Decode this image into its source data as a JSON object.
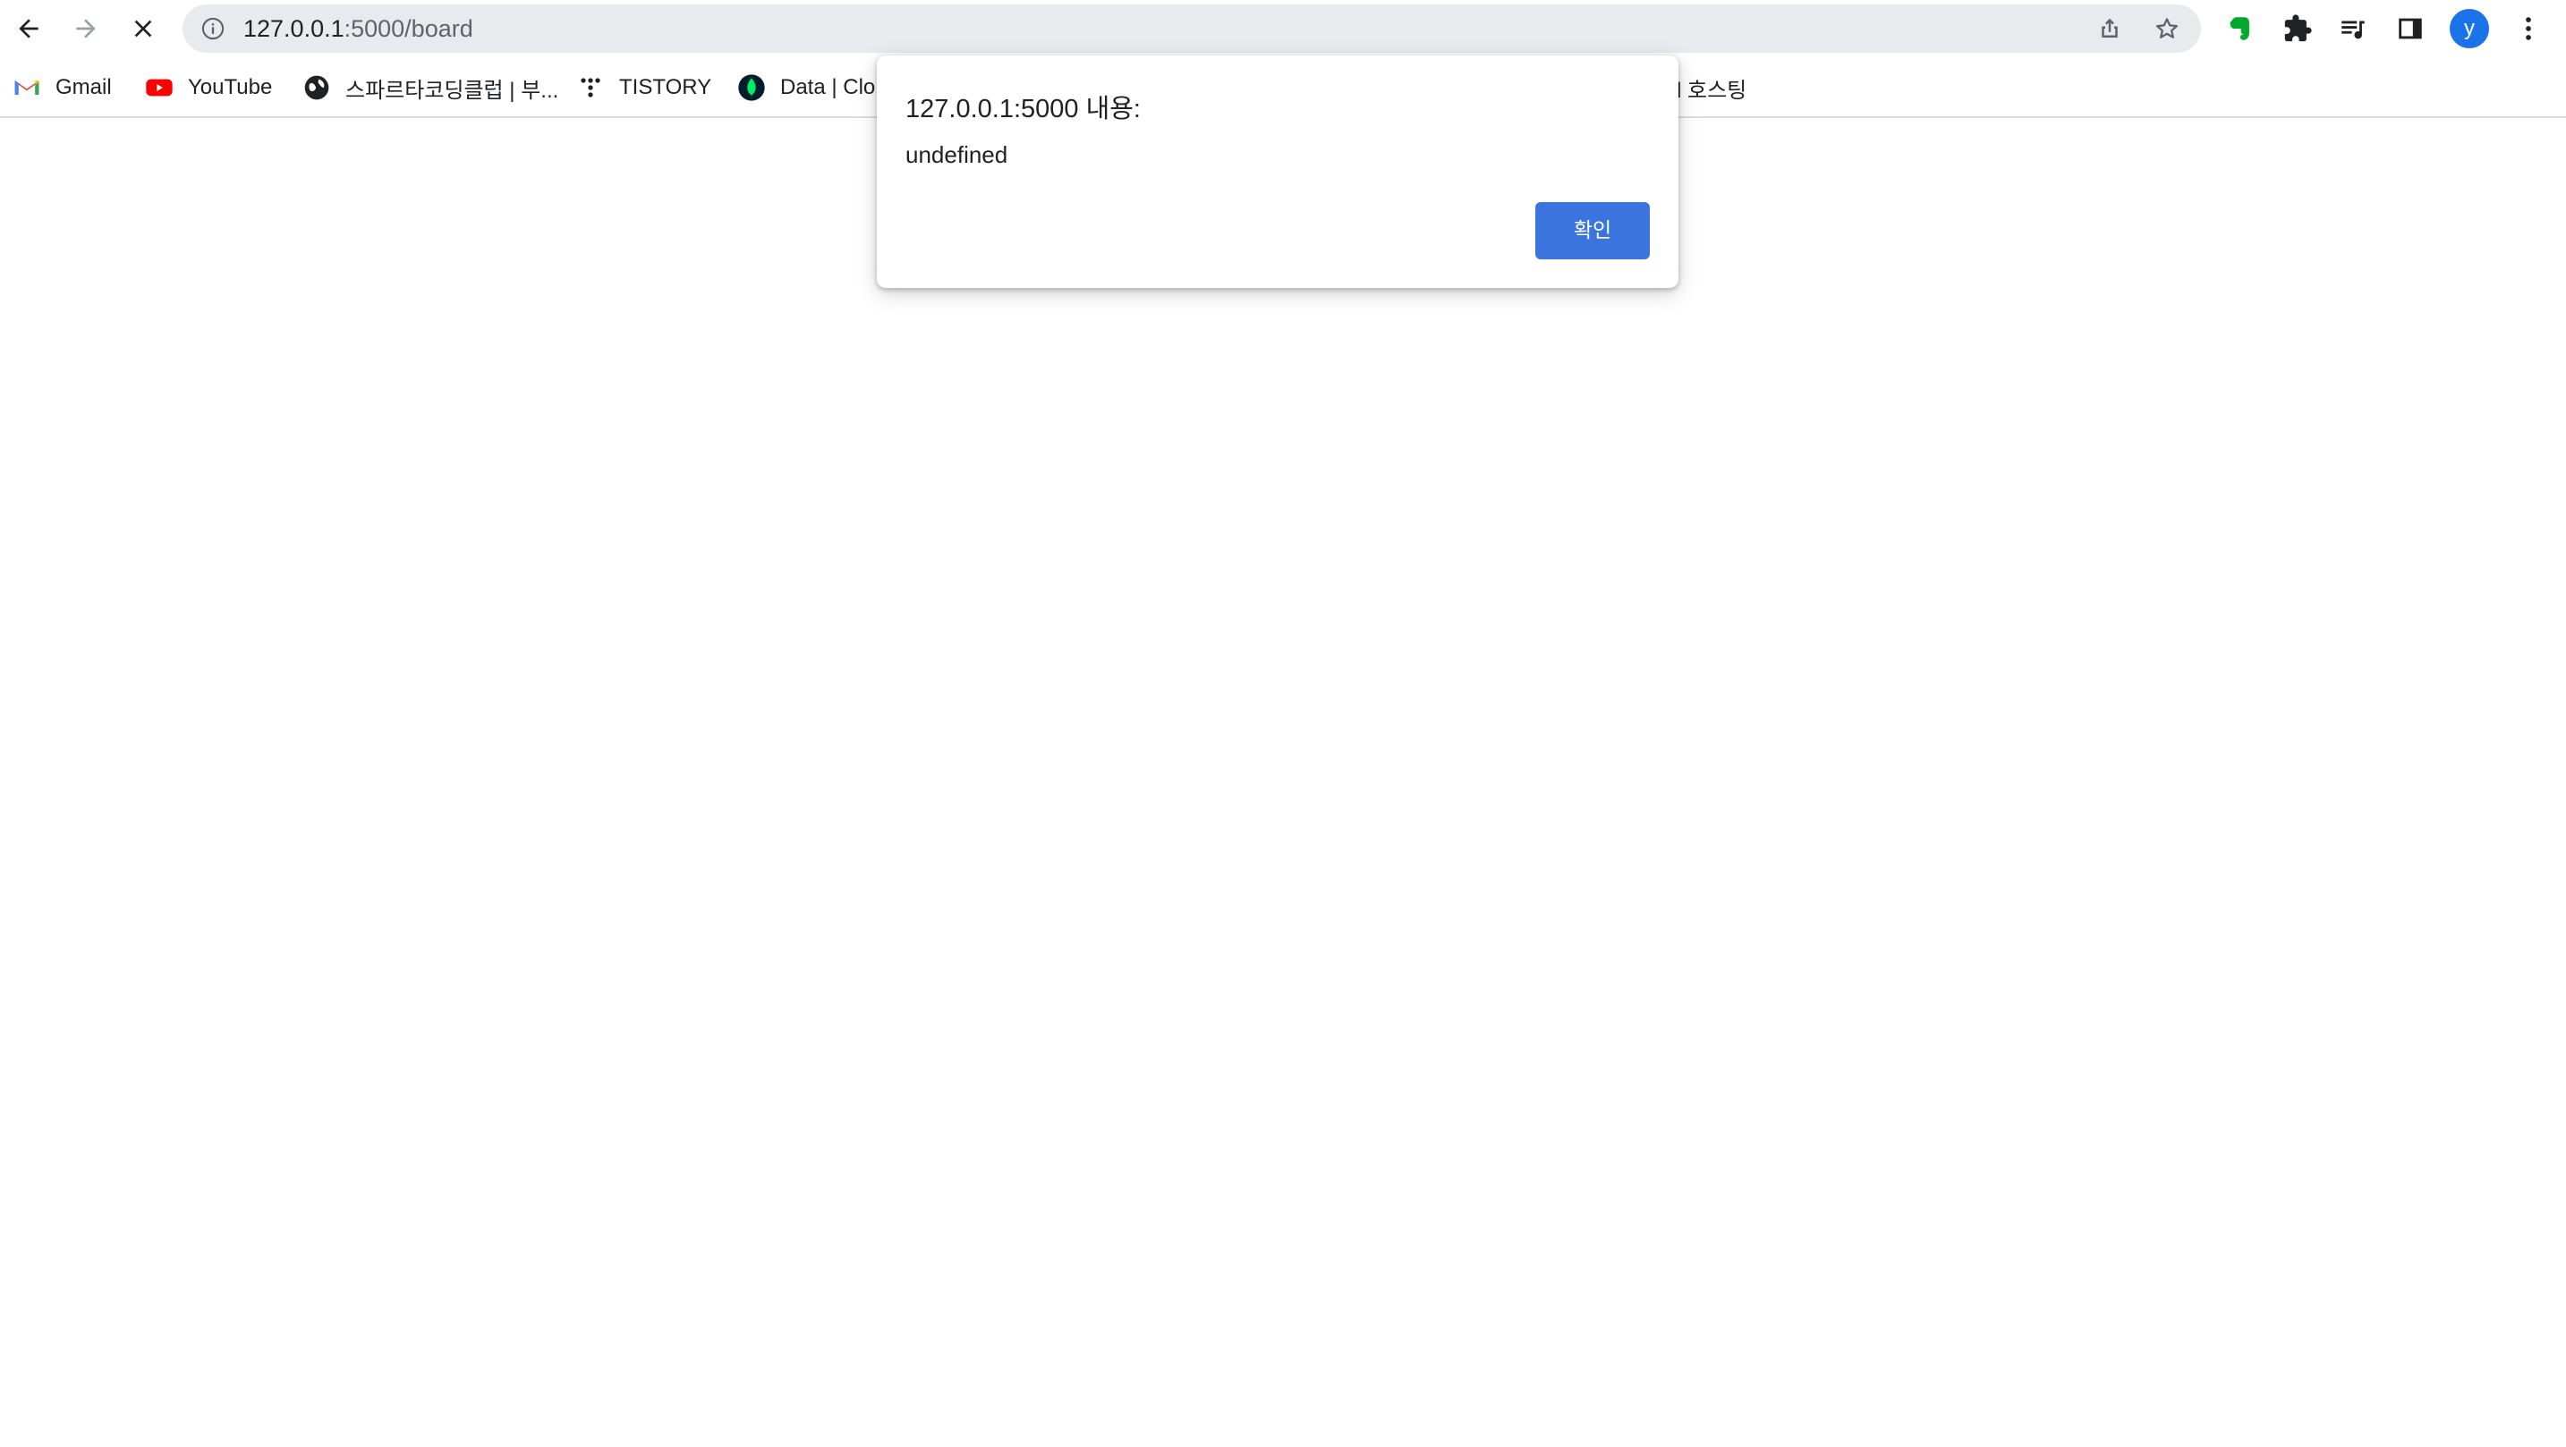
{
  "browser": {
    "url_host": "127.0.0.1",
    "url_path": ":5000/board",
    "avatar_letter": "y"
  },
  "bookmarks": [
    {
      "label": "Gmail",
      "icon": "gmail-icon"
    },
    {
      "label": "YouTube",
      "icon": "youtube-icon"
    },
    {
      "label": "스파르타코딩클럽 | 부...",
      "icon": "globe-icon"
    },
    {
      "label": "TISTORY",
      "icon": "tistory-icon"
    },
    {
      "label": "Data | Clo",
      "icon": "mongodb-leaf-icon"
    },
    {
      "label": "l 호스팅",
      "icon": ""
    }
  ],
  "dialog": {
    "title": "127.0.0.1:5000 내용:",
    "message": "undefined",
    "ok_label": "확인"
  },
  "colors": {
    "accent": "#3b74dc",
    "omnibox": "#e8eaed",
    "youtube": "#ff0000",
    "evernote": "#00a82d"
  }
}
